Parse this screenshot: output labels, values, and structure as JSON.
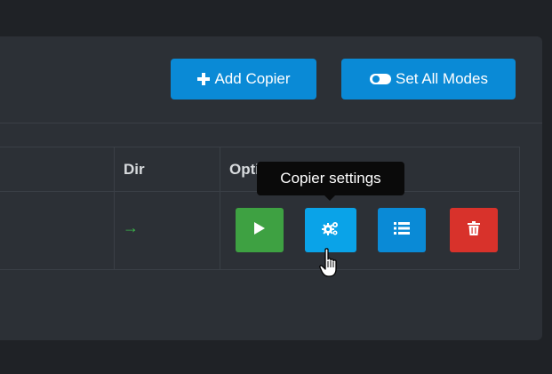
{
  "toolbar": {
    "add_copier_label": "Add Copier",
    "set_all_modes_label": "Set All Modes"
  },
  "table": {
    "columns": [
      "Dir",
      "Options"
    ],
    "rows": [
      {
        "dir": "→"
      }
    ]
  },
  "tooltip": {
    "text": "Copier settings"
  },
  "actions": {
    "start_icon": "play-icon",
    "settings_icon": "cogs-icon",
    "list_icon": "list-icon",
    "delete_icon": "trash-icon"
  },
  "colors": {
    "primary": "#0a8ad6",
    "settings": "#0aa3e8",
    "success": "#3ea142",
    "danger": "#d8322b",
    "arrow": "#3ab44a",
    "panel": "#2c3036",
    "background": "#1f2226"
  }
}
